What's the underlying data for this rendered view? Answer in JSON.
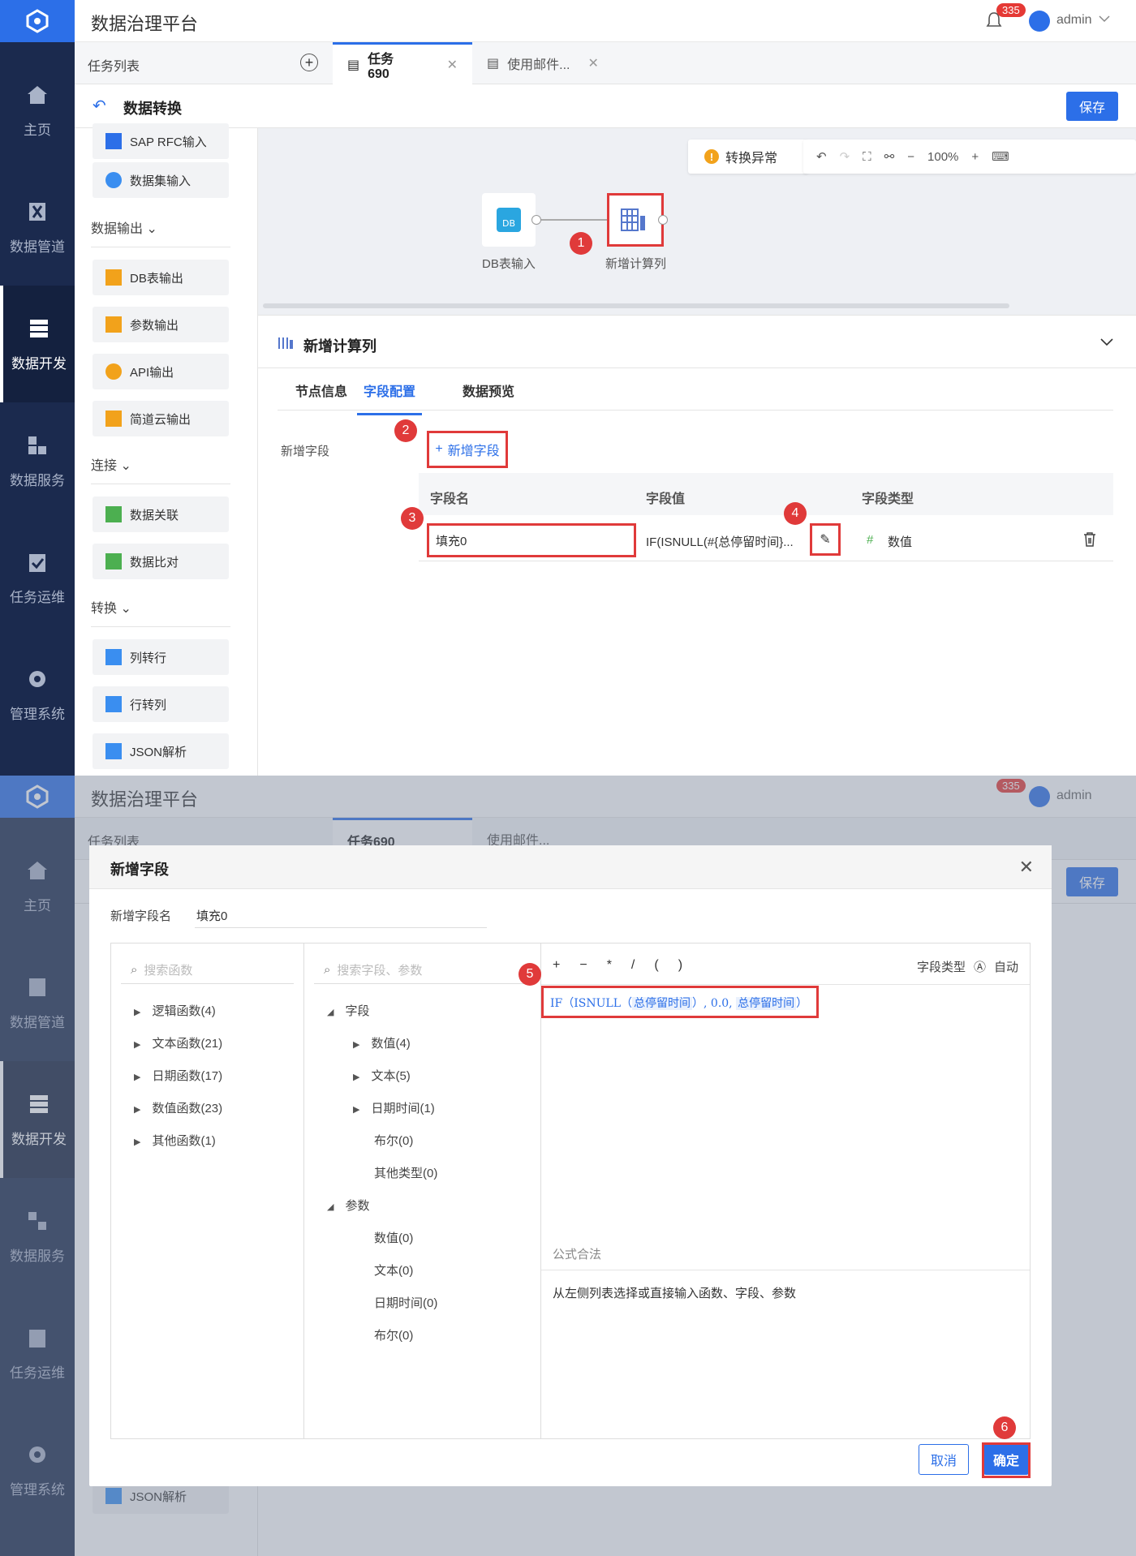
{
  "app": {
    "title": "数据治理平台",
    "notifications": "335",
    "user": "admin"
  },
  "nav": [
    {
      "label": "主页",
      "icon": "home-icon"
    },
    {
      "label": "数据管道",
      "icon": "pipeline-icon"
    },
    {
      "label": "数据开发",
      "icon": "dev-icon"
    },
    {
      "label": "数据服务",
      "icon": "service-icon"
    },
    {
      "label": "任务运维",
      "icon": "ops-icon"
    },
    {
      "label": "管理系统",
      "icon": "gear-icon"
    }
  ],
  "tabs": {
    "task_list": "任务列表",
    "tab1": "任务690",
    "tab2": "使用邮件..."
  },
  "page": {
    "title": "数据转换",
    "save": "保存"
  },
  "left": {
    "items_top": [
      "SAP RFC输入",
      "数据集输入"
    ],
    "sec_output": "数据输出",
    "output_items": [
      "DB表输出",
      "参数输出",
      "API输出",
      "简道云输出"
    ],
    "sec_join": "连接",
    "join_items": [
      "数据关联",
      "数据比对"
    ],
    "sec_transform": "转换",
    "transform_items": [
      "列转行",
      "行转列",
      "JSON解析"
    ]
  },
  "canvas": {
    "error": "转换异常",
    "zoom": "100%",
    "node1": "DB表输入",
    "node2": "新增计算列"
  },
  "props": {
    "title": "新增计算列",
    "tabs": [
      "节点信息",
      "字段配置",
      "数据预览"
    ],
    "label_add": "新增字段",
    "add_btn": "新增字段",
    "headers": [
      "字段名",
      "字段值",
      "字段类型"
    ],
    "row": {
      "name": "填充0",
      "value": "IF(ISNULL(#{总停留时间}...",
      "type": "数值"
    }
  },
  "modal": {
    "title": "新增字段",
    "name_label": "新增字段名",
    "name_value": "填充0",
    "search_func": "搜索函数",
    "search_field": "搜索字段、参数",
    "funcs": [
      "逻辑函数(4)",
      "文本函数(21)",
      "日期函数(17)",
      "数值函数(23)",
      "其他函数(1)"
    ],
    "fields_root": "字段",
    "fields": [
      "数值(4)",
      "文本(5)",
      "日期时间(1)",
      "布尔(0)",
      "其他类型(0)"
    ],
    "params_root": "参数",
    "params": [
      "数值(0)",
      "文本(0)",
      "日期时间(0)",
      "布尔(0)"
    ],
    "ops": [
      "+",
      "−",
      "*",
      "/",
      "(",
      ")"
    ],
    "type_label": "字段类型",
    "type_value": "自动",
    "formula": {
      "p1": "IF（ISNULL（",
      "c1": "总停留时间",
      "p2": "）, 0.0, ",
      "c2": "总停留时间",
      "p3": "）"
    },
    "valid_label": "公式合法",
    "hint": "从左侧列表选择或直接输入函数、字段、参数",
    "cancel": "取消",
    "ok": "确定"
  },
  "markers": [
    "1",
    "2",
    "3",
    "4",
    "5",
    "6"
  ],
  "colors": {
    "primary": "#2c6fe8",
    "nav": "#1b2a4e",
    "marker": "#e03a3a"
  }
}
